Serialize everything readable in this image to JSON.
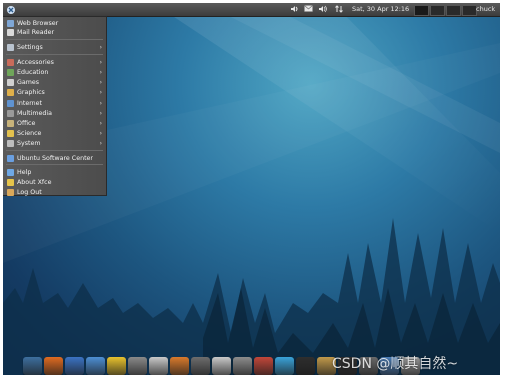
{
  "topbar": {
    "clock": "Sat, 30 Apr 12:16",
    "username": "chuck",
    "tray_icons": [
      "volume-icon",
      "mail-icon",
      "speaker-icon",
      "network-icon"
    ],
    "workspaces": 4,
    "active_workspace": 1
  },
  "menu": {
    "items": [
      {
        "label": "Web Browser",
        "icon": "globe-icon",
        "submenu": false,
        "color": "#7fa7d6"
      },
      {
        "label": "Mail Reader",
        "icon": "mail-icon",
        "submenu": false,
        "color": "#d9d9d9"
      },
      {
        "label": "Settings",
        "icon": "settings-icon",
        "submenu": true,
        "color": "#b9c3cf"
      },
      {
        "label": "Accessories",
        "icon": "accessories-icon",
        "submenu": true,
        "color": "#c96b5a"
      },
      {
        "label": "Education",
        "icon": "education-icon",
        "submenu": true,
        "color": "#6fa65a"
      },
      {
        "label": "Games",
        "icon": "games-icon",
        "submenu": true,
        "color": "#d0d0d0"
      },
      {
        "label": "Graphics",
        "icon": "graphics-icon",
        "submenu": true,
        "color": "#e0b04a"
      },
      {
        "label": "Internet",
        "icon": "internet-icon",
        "submenu": true,
        "color": "#5f93d1"
      },
      {
        "label": "Multimedia",
        "icon": "multimedia-icon",
        "submenu": true,
        "color": "#9a9a9a"
      },
      {
        "label": "Office",
        "icon": "office-icon",
        "submenu": true,
        "color": "#c8b37a"
      },
      {
        "label": "Science",
        "icon": "science-icon",
        "submenu": true,
        "color": "#e3c14d"
      },
      {
        "label": "System",
        "icon": "system-icon",
        "submenu": true,
        "color": "#bdbdbd"
      },
      {
        "label": "Ubuntu Software Center",
        "icon": "software-center-icon",
        "submenu": false,
        "color": "#6a9fe0"
      },
      {
        "label": "Help",
        "icon": "help-icon",
        "submenu": false,
        "color": "#6ea8e6"
      },
      {
        "label": "About Xfce",
        "icon": "star-icon",
        "submenu": false,
        "color": "#e6c44a"
      },
      {
        "label": "Log Out",
        "icon": "logout-icon",
        "submenu": false,
        "color": "#d9a85a"
      }
    ]
  },
  "dock": {
    "apps": [
      {
        "name": "show-desktop-icon",
        "color": "#3d6f9f"
      },
      {
        "name": "firefox-icon",
        "color": "#e06b21"
      },
      {
        "name": "thunderbird-icon",
        "color": "#3b73c4"
      },
      {
        "name": "settings-manager-icon",
        "color": "#4d8fd4"
      },
      {
        "name": "media-player-icon",
        "color": "#e8c22e"
      },
      {
        "name": "text-editor-icon",
        "color": "#8a8a8a"
      },
      {
        "name": "notes-icon",
        "color": "#c9c9c9"
      },
      {
        "name": "document-viewer-icon",
        "color": "#d97a2c"
      },
      {
        "name": "screenshot-icon",
        "color": "#6d6d6d"
      },
      {
        "name": "image-viewer-icon",
        "color": "#c9c9c9"
      },
      {
        "name": "system-settings-icon",
        "color": "#8d8d8d"
      },
      {
        "name": "network-icon",
        "color": "#c2473a"
      },
      {
        "name": "gem-icon",
        "color": "#3aa3d9"
      },
      {
        "name": "terminal-icon",
        "color": "#2e2e2e"
      },
      {
        "name": "package-icon",
        "color": "#c19a4b"
      },
      {
        "name": "console-icon",
        "color": "#303030"
      },
      {
        "name": "search-icon",
        "color": "#6a6a6a"
      },
      {
        "name": "folder-icon",
        "color": "#4f84c0"
      },
      {
        "name": "trash-icon",
        "color": "#9b9b9b"
      }
    ]
  },
  "watermark": "CSDN @顺其自然~"
}
